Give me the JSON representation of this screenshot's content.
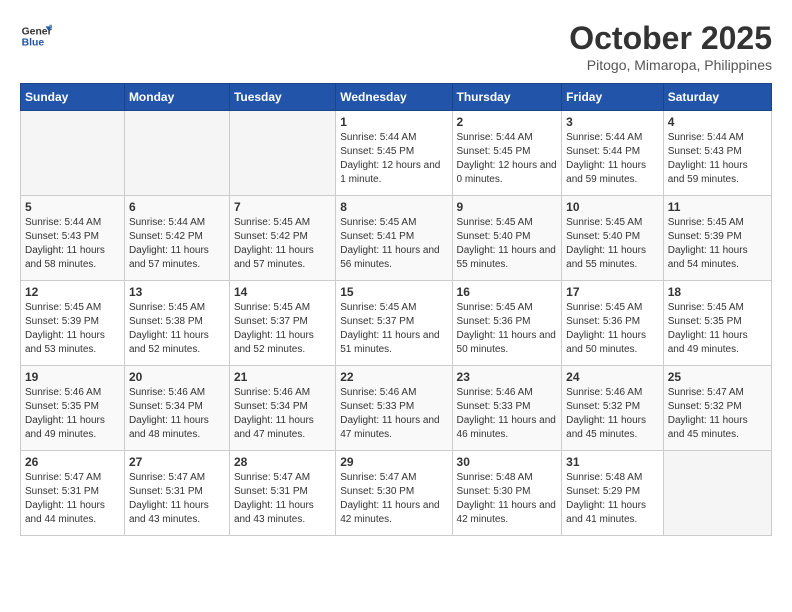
{
  "header": {
    "logo_general": "General",
    "logo_blue": "Blue",
    "month": "October 2025",
    "location": "Pitogo, Mimaropa, Philippines"
  },
  "days_of_week": [
    "Sunday",
    "Monday",
    "Tuesday",
    "Wednesday",
    "Thursday",
    "Friday",
    "Saturday"
  ],
  "weeks": [
    [
      {
        "day": "",
        "info": ""
      },
      {
        "day": "",
        "info": ""
      },
      {
        "day": "",
        "info": ""
      },
      {
        "day": "1",
        "info": "Sunrise: 5:44 AM\nSunset: 5:45 PM\nDaylight: 12 hours and 1 minute."
      },
      {
        "day": "2",
        "info": "Sunrise: 5:44 AM\nSunset: 5:45 PM\nDaylight: 12 hours and 0 minutes."
      },
      {
        "day": "3",
        "info": "Sunrise: 5:44 AM\nSunset: 5:44 PM\nDaylight: 11 hours and 59 minutes."
      },
      {
        "day": "4",
        "info": "Sunrise: 5:44 AM\nSunset: 5:43 PM\nDaylight: 11 hours and 59 minutes."
      }
    ],
    [
      {
        "day": "5",
        "info": "Sunrise: 5:44 AM\nSunset: 5:43 PM\nDaylight: 11 hours and 58 minutes."
      },
      {
        "day": "6",
        "info": "Sunrise: 5:44 AM\nSunset: 5:42 PM\nDaylight: 11 hours and 57 minutes."
      },
      {
        "day": "7",
        "info": "Sunrise: 5:45 AM\nSunset: 5:42 PM\nDaylight: 11 hours and 57 minutes."
      },
      {
        "day": "8",
        "info": "Sunrise: 5:45 AM\nSunset: 5:41 PM\nDaylight: 11 hours and 56 minutes."
      },
      {
        "day": "9",
        "info": "Sunrise: 5:45 AM\nSunset: 5:40 PM\nDaylight: 11 hours and 55 minutes."
      },
      {
        "day": "10",
        "info": "Sunrise: 5:45 AM\nSunset: 5:40 PM\nDaylight: 11 hours and 55 minutes."
      },
      {
        "day": "11",
        "info": "Sunrise: 5:45 AM\nSunset: 5:39 PM\nDaylight: 11 hours and 54 minutes."
      }
    ],
    [
      {
        "day": "12",
        "info": "Sunrise: 5:45 AM\nSunset: 5:39 PM\nDaylight: 11 hours and 53 minutes."
      },
      {
        "day": "13",
        "info": "Sunrise: 5:45 AM\nSunset: 5:38 PM\nDaylight: 11 hours and 52 minutes."
      },
      {
        "day": "14",
        "info": "Sunrise: 5:45 AM\nSunset: 5:37 PM\nDaylight: 11 hours and 52 minutes."
      },
      {
        "day": "15",
        "info": "Sunrise: 5:45 AM\nSunset: 5:37 PM\nDaylight: 11 hours and 51 minutes."
      },
      {
        "day": "16",
        "info": "Sunrise: 5:45 AM\nSunset: 5:36 PM\nDaylight: 11 hours and 50 minutes."
      },
      {
        "day": "17",
        "info": "Sunrise: 5:45 AM\nSunset: 5:36 PM\nDaylight: 11 hours and 50 minutes."
      },
      {
        "day": "18",
        "info": "Sunrise: 5:45 AM\nSunset: 5:35 PM\nDaylight: 11 hours and 49 minutes."
      }
    ],
    [
      {
        "day": "19",
        "info": "Sunrise: 5:46 AM\nSunset: 5:35 PM\nDaylight: 11 hours and 49 minutes."
      },
      {
        "day": "20",
        "info": "Sunrise: 5:46 AM\nSunset: 5:34 PM\nDaylight: 11 hours and 48 minutes."
      },
      {
        "day": "21",
        "info": "Sunrise: 5:46 AM\nSunset: 5:34 PM\nDaylight: 11 hours and 47 minutes."
      },
      {
        "day": "22",
        "info": "Sunrise: 5:46 AM\nSunset: 5:33 PM\nDaylight: 11 hours and 47 minutes."
      },
      {
        "day": "23",
        "info": "Sunrise: 5:46 AM\nSunset: 5:33 PM\nDaylight: 11 hours and 46 minutes."
      },
      {
        "day": "24",
        "info": "Sunrise: 5:46 AM\nSunset: 5:32 PM\nDaylight: 11 hours and 45 minutes."
      },
      {
        "day": "25",
        "info": "Sunrise: 5:47 AM\nSunset: 5:32 PM\nDaylight: 11 hours and 45 minutes."
      }
    ],
    [
      {
        "day": "26",
        "info": "Sunrise: 5:47 AM\nSunset: 5:31 PM\nDaylight: 11 hours and 44 minutes."
      },
      {
        "day": "27",
        "info": "Sunrise: 5:47 AM\nSunset: 5:31 PM\nDaylight: 11 hours and 43 minutes."
      },
      {
        "day": "28",
        "info": "Sunrise: 5:47 AM\nSunset: 5:31 PM\nDaylight: 11 hours and 43 minutes."
      },
      {
        "day": "29",
        "info": "Sunrise: 5:47 AM\nSunset: 5:30 PM\nDaylight: 11 hours and 42 minutes."
      },
      {
        "day": "30",
        "info": "Sunrise: 5:48 AM\nSunset: 5:30 PM\nDaylight: 11 hours and 42 minutes."
      },
      {
        "day": "31",
        "info": "Sunrise: 5:48 AM\nSunset: 5:29 PM\nDaylight: 11 hours and 41 minutes."
      },
      {
        "day": "",
        "info": ""
      }
    ]
  ]
}
